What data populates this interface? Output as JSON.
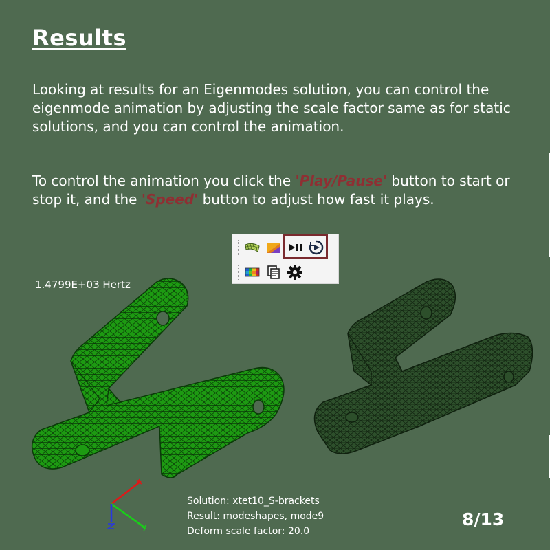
{
  "slide": {
    "title": "Results",
    "paragraph1": "Looking at results for an Eigenmodes solution, you can control the eigenmode animation by adjusting the scale factor same as for static solutions, and you can control the animation.",
    "p2_part1": "To control the animation you click the ",
    "p2_kw1": "Play/Pause",
    "p2_part2": " button to start or stop it, and the ",
    "p2_kw2": "Speed",
    "p2_part3": " button to adjust how fast it plays.",
    "page": "8/13"
  },
  "viewport": {
    "frequency": "1.4799E+03 Hertz",
    "solution": "Solution: xtet10_S-brackets",
    "result": "Result: modeshapes, mode9",
    "deform": "Deform scale factor: 20.0"
  },
  "toolbar": {
    "row1": [
      "deformed-mesh-icon",
      "contour-fringe-icon",
      "play-pause-icon",
      "speed-icon"
    ],
    "row2": [
      "color-legend-icon",
      "copy-icon",
      "settings-gear-icon"
    ]
  },
  "colors": {
    "background": "#4f6a50",
    "highlight": "#8f2f33",
    "mesh_deformed": "#1d9a12",
    "mesh_original": "#2d4f2b"
  }
}
